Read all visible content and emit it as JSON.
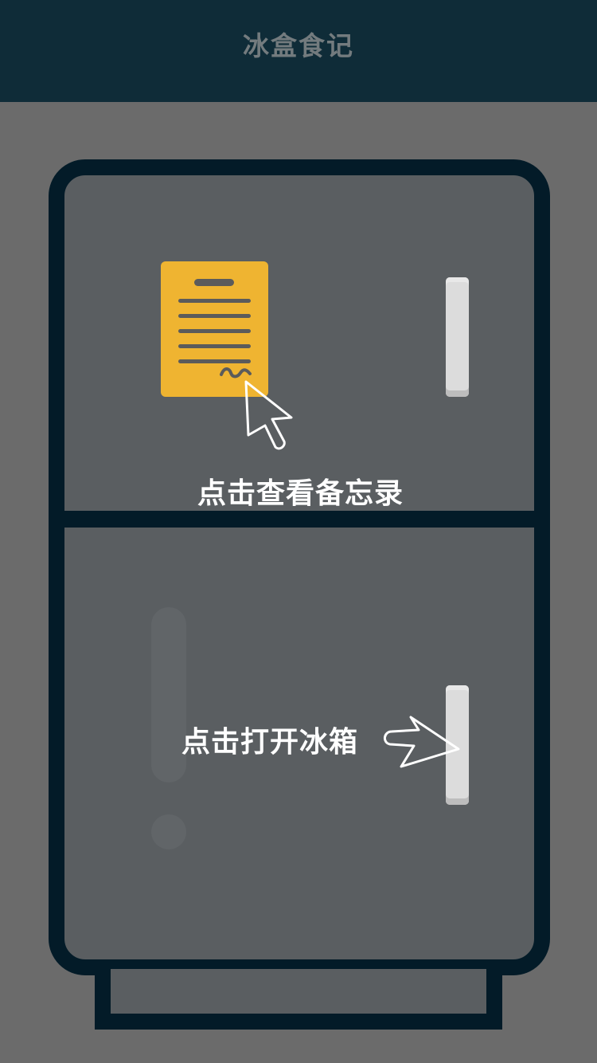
{
  "header": {
    "title": "冰盒食记"
  },
  "fridge": {
    "memo_hint": "点击查看备忘录",
    "open_hint": "点击打开冰箱"
  },
  "icons": {
    "memo": "memo-document-icon",
    "pointer": "arrow-cursor-icon",
    "hand": "pointing-hand-icon"
  },
  "colors": {
    "header_bg": "#0f2c38",
    "page_bg": "#6b6b6b",
    "fridge_outline": "#031b28",
    "fridge_panel": "#5a5e61",
    "memo_yellow": "#efb431",
    "handle": "#dcdcdc"
  }
}
